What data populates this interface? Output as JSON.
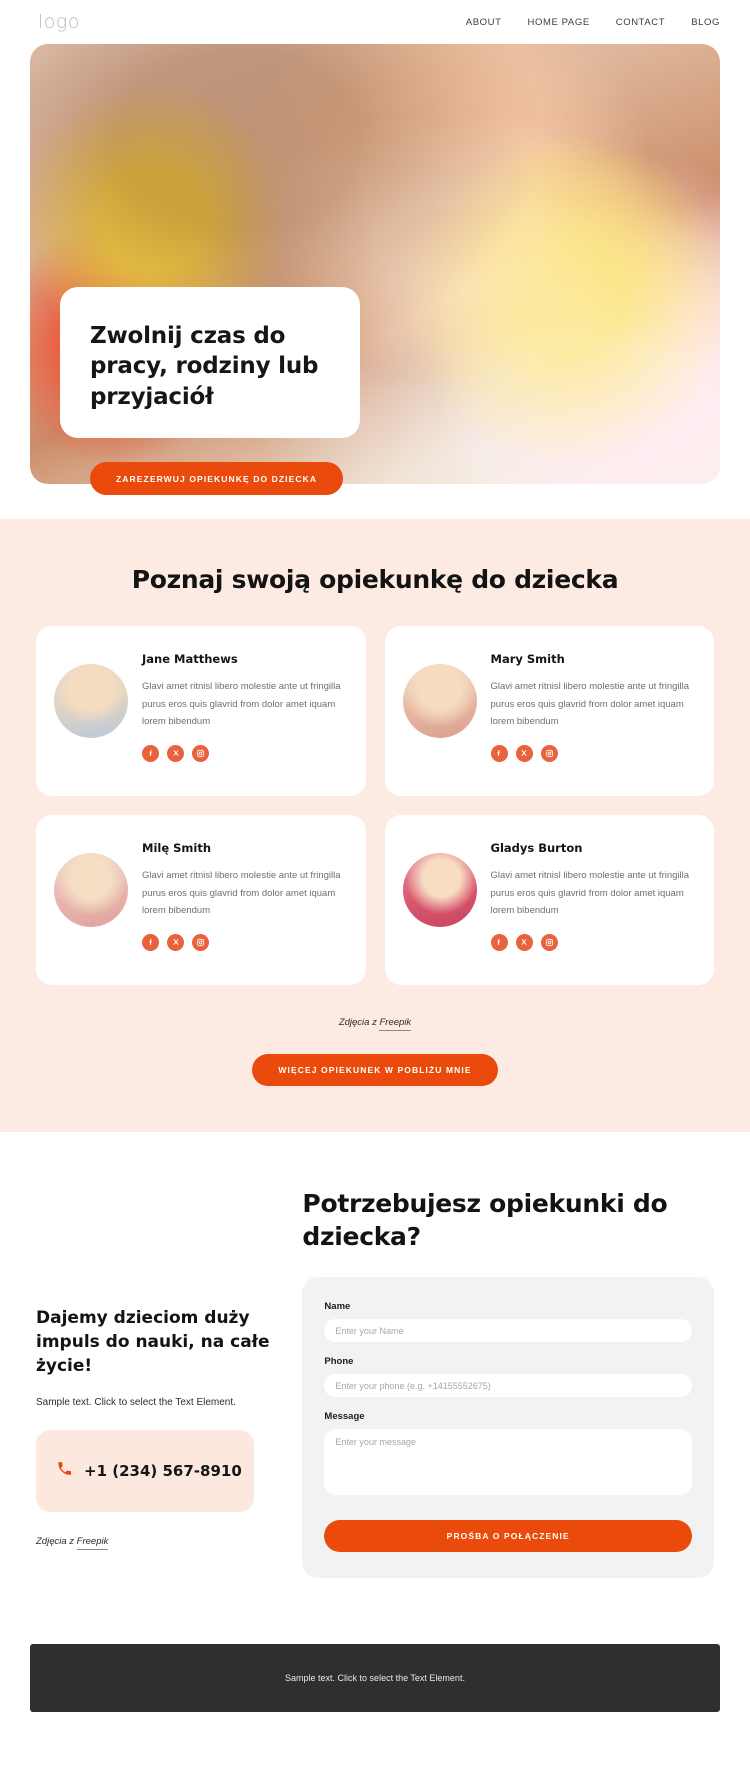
{
  "header": {
    "logo": "logo",
    "nav": [
      {
        "label": "ABOUT"
      },
      {
        "label": "HOME PAGE"
      },
      {
        "label": "CONTACT"
      },
      {
        "label": "BLOG"
      }
    ]
  },
  "hero": {
    "title": "Zwolnij czas  do pracy, rodziny lub przyjaciół",
    "cta_label": "ZAREZERWUJ OPIEKUNKĘ DO DZIECKA",
    "accent_color": "#ea4b0c"
  },
  "team": {
    "heading": "Poznaj swoją opiekunkę do dziecka",
    "background_color": "#fdeae2",
    "members": [
      {
        "name": "Jane Matthews",
        "description": "Glavi amet ritnisl libero molestie ante ut fringilla purus eros quis glavrid from dolor amet iquam lorem bibendum"
      },
      {
        "name": "Mary Smith",
        "description": "Glavi amet ritnisl libero molestie ante ut fringilla purus eros quis glavrid from dolor amet iquam lorem bibendum"
      },
      {
        "name": "Milę Smith",
        "description": "Glavi amet ritnisl libero molestie ante ut fringilla purus eros quis glavrid from dolor amet iquam lorem bibendum"
      },
      {
        "name": "Gladys Burton",
        "description": "Glavi amet ritnisl libero molestie ante ut fringilla purus eros quis glavrid from dolor amet iquam lorem bibendum"
      }
    ],
    "socials": [
      {
        "name": "facebook"
      },
      {
        "name": "x-twitter"
      },
      {
        "name": "instagram"
      }
    ],
    "credit_prefix": "Zdjęcia z ",
    "credit_link": "Freepik",
    "cta_label": "WIĘCEJ OPIEKUNEK W POBLIŻU MNIE"
  },
  "contact": {
    "left_heading": "Dajemy dzieciom duży impuls do nauki, na całe życie!",
    "sample_text": "Sample text. Click to select the Text Element.",
    "phone": "+1 (234) 567-8910",
    "credit_prefix": "Zdjęcia z ",
    "credit_link": "Freepik",
    "right_heading": "Potrzebujesz opiekunki do dziecka?",
    "form": {
      "name_label": "Name",
      "name_placeholder": "Enter your Name",
      "name_value": "",
      "phone_label": "Phone",
      "phone_placeholder": "Enter your phone (e.g. +14155552675)",
      "phone_value": "",
      "message_label": "Message",
      "message_placeholder": "Enter your message",
      "message_value": "",
      "submit_label": "PROŚBA O POŁĄCZENIE"
    }
  },
  "footer": {
    "text": "Sample text. Click to select the Text Element.",
    "background_color": "#2f2f2f"
  }
}
